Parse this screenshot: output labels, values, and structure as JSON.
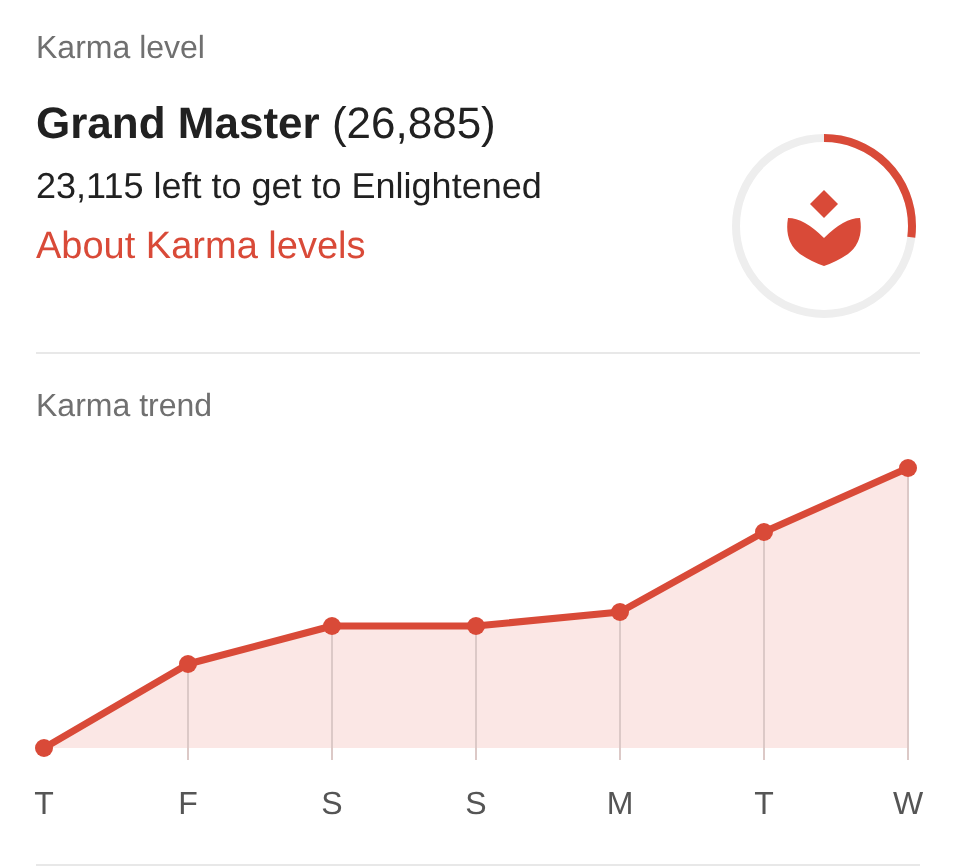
{
  "karma_level": {
    "heading": "Karma level",
    "rank": "Grand Master",
    "points": "(26,885)",
    "remaining": "23,115 left to get to Enlightened",
    "link": "About Karma levels",
    "level": 0.27
  },
  "karma_trend": {
    "heading": "Karma trend",
    "days": [
      "T",
      "F",
      "S",
      "S",
      "M",
      "T",
      "W"
    ]
  }
}
